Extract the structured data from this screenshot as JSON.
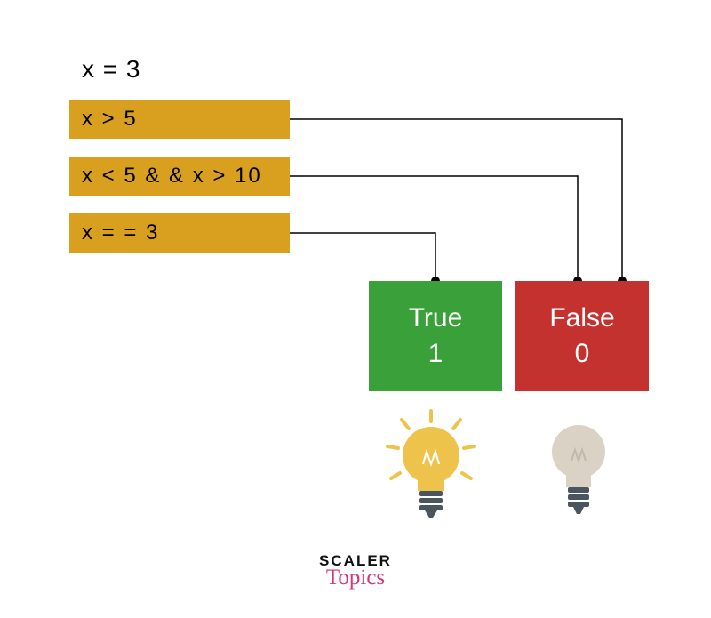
{
  "assignment": "x = 3",
  "expressions": [
    {
      "text": "x > 5",
      "result": "False"
    },
    {
      "text": "x < 5 & & x > 10",
      "result": "False"
    },
    {
      "text": "x = = 3",
      "result": "True"
    }
  ],
  "results": {
    "true": {
      "label": "True",
      "value": "1",
      "bulb": "on",
      "color": "#3aa03a"
    },
    "false": {
      "label": "False",
      "value": "0",
      "bulb": "off",
      "color": "#c4322f"
    }
  },
  "brand": {
    "line1": "SCALER",
    "line2": "Topics"
  },
  "colors": {
    "expr_bg": "#d9a020",
    "wire": "#000000",
    "bulb_on": "#eec34b",
    "bulb_off": "#d9d2c5",
    "bulb_base": "#4a5560"
  }
}
